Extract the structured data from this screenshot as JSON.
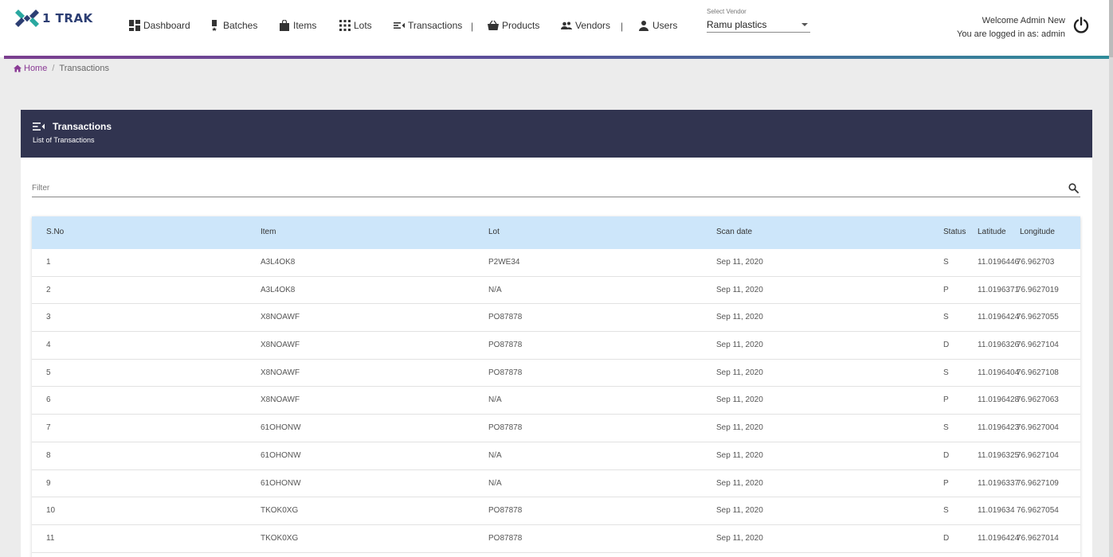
{
  "app": {
    "logo_text": "1 TRAK"
  },
  "nav": {
    "dashboard": "Dashboard",
    "batches": "Batches",
    "items": "Items",
    "lots": "Lots",
    "transactions": "Transactions",
    "products": "Products",
    "vendors": "Vendors",
    "users": "Users",
    "separator": "|"
  },
  "vendor_select": {
    "label": "Select Vendor",
    "value": "Ramu plastics"
  },
  "user": {
    "welcome": "Welcome Admin New",
    "logged_in": "You are logged in as: admin"
  },
  "breadcrumb": {
    "home": "Home",
    "separator": "/",
    "current": "Transactions"
  },
  "card": {
    "title": "Transactions",
    "subtitle": "List of Transactions"
  },
  "filter": {
    "placeholder": "Filter"
  },
  "table": {
    "headers": {
      "sno": "S.No",
      "item": "Item",
      "lot": "Lot",
      "scan_date": "Scan date",
      "status": "Status",
      "latitude": "Latitude",
      "longitude": "Longitude"
    },
    "rows": [
      {
        "sno": "1",
        "item": "A3L4OK8",
        "lot": "P2WE34",
        "scan_date": "Sep 11, 2020",
        "status": "S",
        "latitude": "11.0196446",
        "longitude": "76.962703"
      },
      {
        "sno": "2",
        "item": "A3L4OK8",
        "lot": "N/A",
        "scan_date": "Sep 11, 2020",
        "status": "P",
        "latitude": "11.0196371",
        "longitude": "76.9627019"
      },
      {
        "sno": "3",
        "item": "X8NOAWF",
        "lot": "PO87878",
        "scan_date": "Sep 11, 2020",
        "status": "S",
        "latitude": "11.0196424",
        "longitude": "76.9627055"
      },
      {
        "sno": "4",
        "item": "X8NOAWF",
        "lot": "PO87878",
        "scan_date": "Sep 11, 2020",
        "status": "D",
        "latitude": "11.0196326",
        "longitude": "76.9627104"
      },
      {
        "sno": "5",
        "item": "X8NOAWF",
        "lot": "PO87878",
        "scan_date": "Sep 11, 2020",
        "status": "S",
        "latitude": "11.0196404",
        "longitude": "76.9627108"
      },
      {
        "sno": "6",
        "item": "X8NOAWF",
        "lot": "N/A",
        "scan_date": "Sep 11, 2020",
        "status": "P",
        "latitude": "11.0196428",
        "longitude": "76.9627063"
      },
      {
        "sno": "7",
        "item": "61OHONW",
        "lot": "PO87878",
        "scan_date": "Sep 11, 2020",
        "status": "S",
        "latitude": "11.0196423",
        "longitude": "76.9627004"
      },
      {
        "sno": "8",
        "item": "61OHONW",
        "lot": "N/A",
        "scan_date": "Sep 11, 2020",
        "status": "D",
        "latitude": "11.0196325",
        "longitude": "76.9627104"
      },
      {
        "sno": "9",
        "item": "61OHONW",
        "lot": "N/A",
        "scan_date": "Sep 11, 2020",
        "status": "P",
        "latitude": "11.0196337",
        "longitude": "76.9627109"
      },
      {
        "sno": "10",
        "item": "TKOK0XG",
        "lot": "PO87878",
        "scan_date": "Sep 11, 2020",
        "status": "S",
        "latitude": "11.019634",
        "longitude": "76.9627054"
      },
      {
        "sno": "11",
        "item": "TKOK0XG",
        "lot": "PO87878",
        "scan_date": "Sep 11, 2020",
        "status": "D",
        "latitude": "11.0196424",
        "longitude": "76.9627014"
      }
    ]
  }
}
